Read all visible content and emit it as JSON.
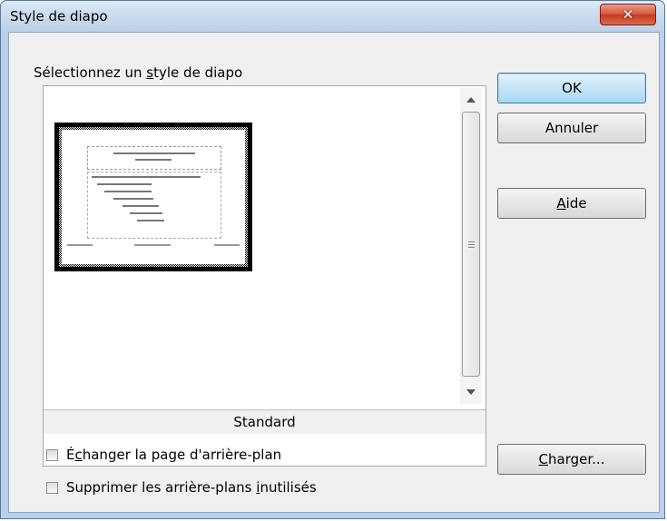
{
  "window": {
    "title": "Style de diapo",
    "close_glyph": "✕"
  },
  "dialog": {
    "select_label_pre": "Sélectionnez un ",
    "select_label_mn": "s",
    "select_label_post": "tyle de diapo",
    "selected_style": "Standard",
    "thumbnail_icon": "slide-layout-thumbnail"
  },
  "buttons": {
    "ok": "OK",
    "cancel": "Annuler",
    "help_mn": "A",
    "help_rest": "ide",
    "load_mn": "C",
    "load_rest": "harger..."
  },
  "options": {
    "swap_pre": "É",
    "swap_mn": "c",
    "swap_post": "hanger la page d'arrière-plan",
    "delete_pre": "Supprimer les arrière-plans ",
    "delete_mn": "i",
    "delete_post": "nutilisés"
  },
  "colors": {
    "close_red": "#c33b1f",
    "default_button_blue": "#a9d9f2"
  }
}
